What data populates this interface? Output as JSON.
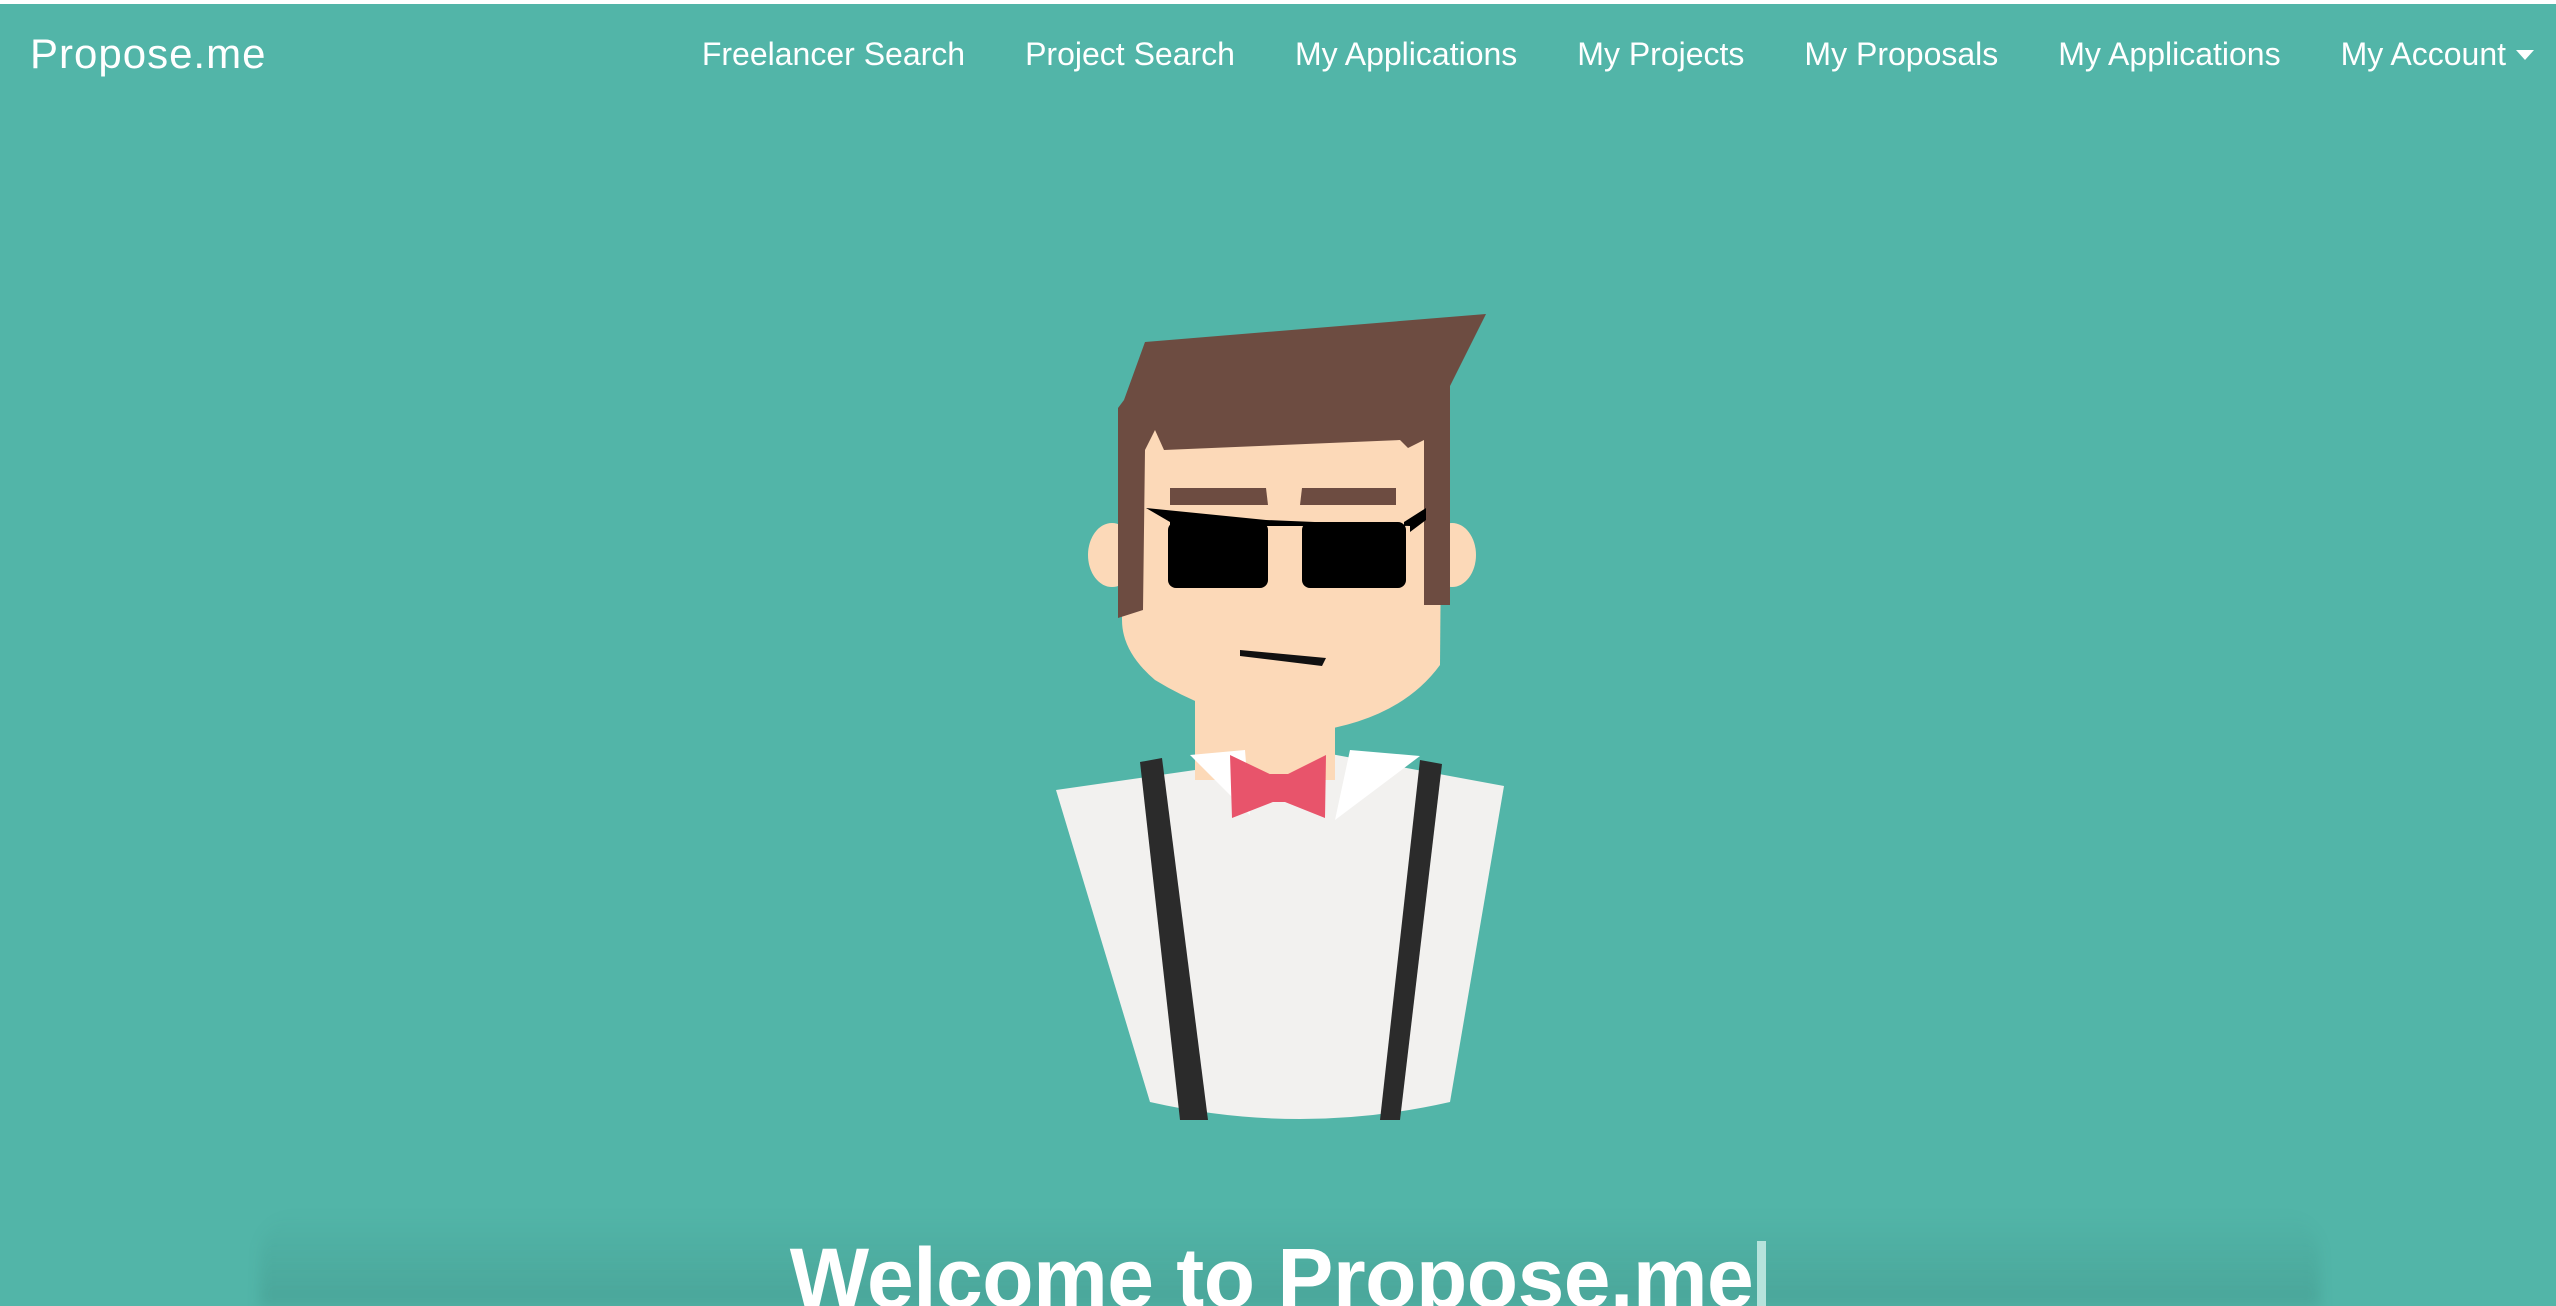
{
  "navbar": {
    "brand": "Propose.me",
    "links": [
      {
        "label": "Freelancer Search"
      },
      {
        "label": "Project Search"
      },
      {
        "label": "My Applications"
      },
      {
        "label": "My Projects"
      },
      {
        "label": "My Proposals"
      },
      {
        "label": "My Applications"
      }
    ],
    "account_label": "My Account",
    "account_icon": "caret-down-icon"
  },
  "hero": {
    "headline": "Welcome to Propose.me",
    "illustration": "hipster-avatar-with-sunglasses-and-bowtie"
  },
  "colors": {
    "background": "#52b5a8",
    "text": "#ffffff",
    "hair": "#6d4c41",
    "skin": "#fcd9b8",
    "glasses": "#000000",
    "bowtie": "#e8546b",
    "shirt": "#f2f1ef",
    "suspenders": "#2b2b2b"
  }
}
